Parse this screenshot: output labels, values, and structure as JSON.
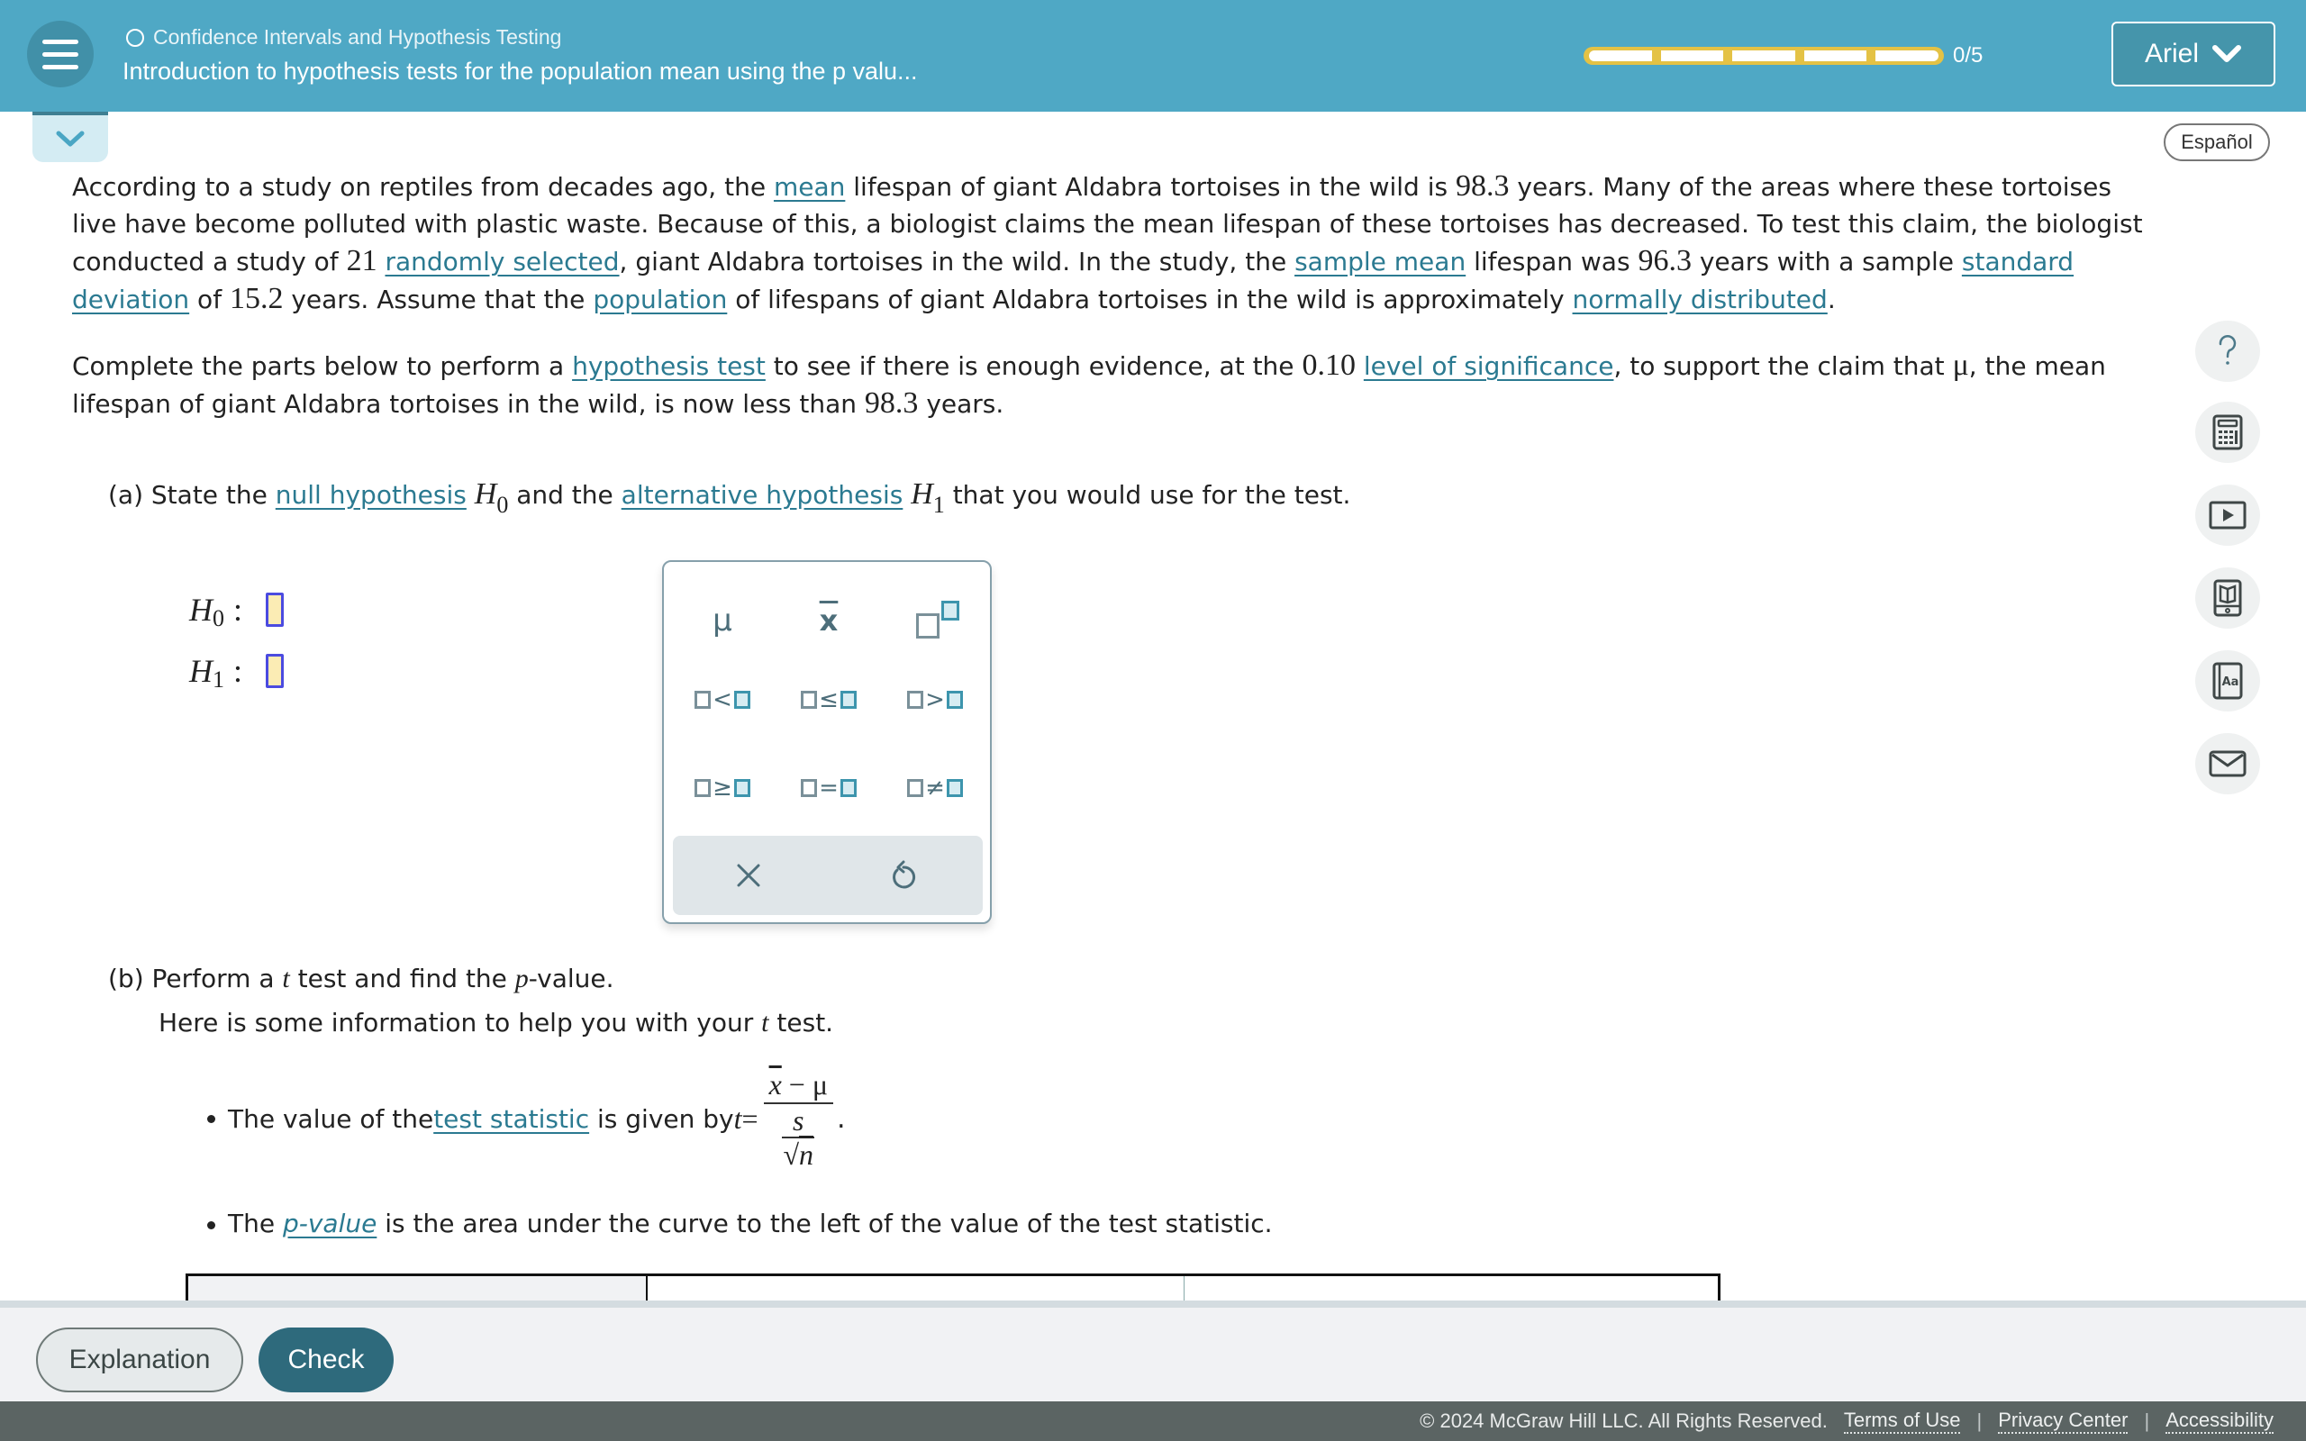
{
  "header": {
    "topic": "Confidence Intervals and Hypothesis Testing",
    "lesson_title": "Introduction to hypothesis tests for the population mean using the p valu...",
    "progress": {
      "completed": 0,
      "total": 5,
      "label": "0/5"
    },
    "user_name": "Ariel",
    "language_button": "Español"
  },
  "problem": {
    "p1": {
      "t1": "According to a study on reptiles from decades ago, the ",
      "l_mean": "mean",
      "t2": " lifespan of giant Aldabra tortoises in the wild is ",
      "n_pop_mean": "98.3",
      "t3": " years. Many of the areas where these tortoises live have become polluted with plastic waste. Because of this, a biologist claims the mean lifespan of these tortoises has decreased. To test this claim, the biologist conducted a study of ",
      "n_sample": "21",
      "l_random": "randomly selected",
      "t4": ", giant Aldabra tortoises in the wild. In the study, the ",
      "l_sample_mean": "sample mean",
      "t5": " lifespan was ",
      "n_sample_mean": "96.3",
      "t6": " years with a sample ",
      "l_sd": "standard deviation",
      "t7": " of ",
      "n_sd": "15.2",
      "t8": " years. Assume that the ",
      "l_population": "population",
      "t9": " of lifespans of giant Aldabra tortoises in the wild is approximately ",
      "l_normal": "normally distributed",
      "t10": "."
    },
    "p2": {
      "t1": "Complete the parts below to perform a ",
      "l_hyp_test": "hypothesis test",
      "t2": " to see if there is enough evidence, at the ",
      "n_alpha": "0.10",
      "l_sig": "level of significance",
      "t3": ", to support the claim that ",
      "mu": "μ",
      "t4": ", the mean lifespan of giant Aldabra tortoises in the wild, is now less than ",
      "n_pop_mean": "98.3",
      "t5": " years."
    },
    "part_a": {
      "t1": "(a) State the ",
      "l_null": "null hypothesis",
      "h0": "H",
      "h0_sub": "0",
      "t2": " and the ",
      "l_alt": "alternative hypothesis",
      "h1": "H",
      "h1_sub": "1",
      "t3": " that you would use for the test.",
      "h0_label": "H",
      "h1_label": "H",
      "h0_value": "",
      "h1_value": ""
    },
    "palette": {
      "mu": "μ",
      "xbar": "x",
      "ops": [
        "<",
        "≤",
        ">",
        "≥",
        "=",
        "≠"
      ]
    },
    "part_b": {
      "t1": "(b) Perform a ",
      "t_var": "t",
      "t2": " test and find the ",
      "p_var": "p",
      "t3": "-value.",
      "help1": "Here is some information to help you with your ",
      "help2": " test.",
      "b1_t1": "The value of the ",
      "b1_link": "test statistic",
      "b1_t2": " is given by ",
      "formula_lhs": "t",
      "formula_eq": "=",
      "formula_x": "x",
      "formula_minus": " − ",
      "formula_mu": "μ",
      "formula_s": "s",
      "formula_n": "n",
      "formula_end": ".",
      "b2_t1": "The ",
      "b2_link": "p-value",
      "b2_t2": " is the area under the curve to the left of the value of the test statistic."
    }
  },
  "actions": {
    "explanation": "Explanation",
    "check": "Check"
  },
  "footer": {
    "copyright": "© 2024 McGraw Hill LLC. All Rights Reserved.",
    "terms": "Terms of Use",
    "privacy": "Privacy Center",
    "accessibility": "Accessibility",
    "sep": "|"
  },
  "colors": {
    "header_bg": "#4fa8c5",
    "link": "#2b7a91",
    "progress_border": "#e4c245",
    "check_bg": "#2e6a7c",
    "answer_box_fill": "#fbecb4",
    "answer_box_border": "#4b4be0"
  }
}
